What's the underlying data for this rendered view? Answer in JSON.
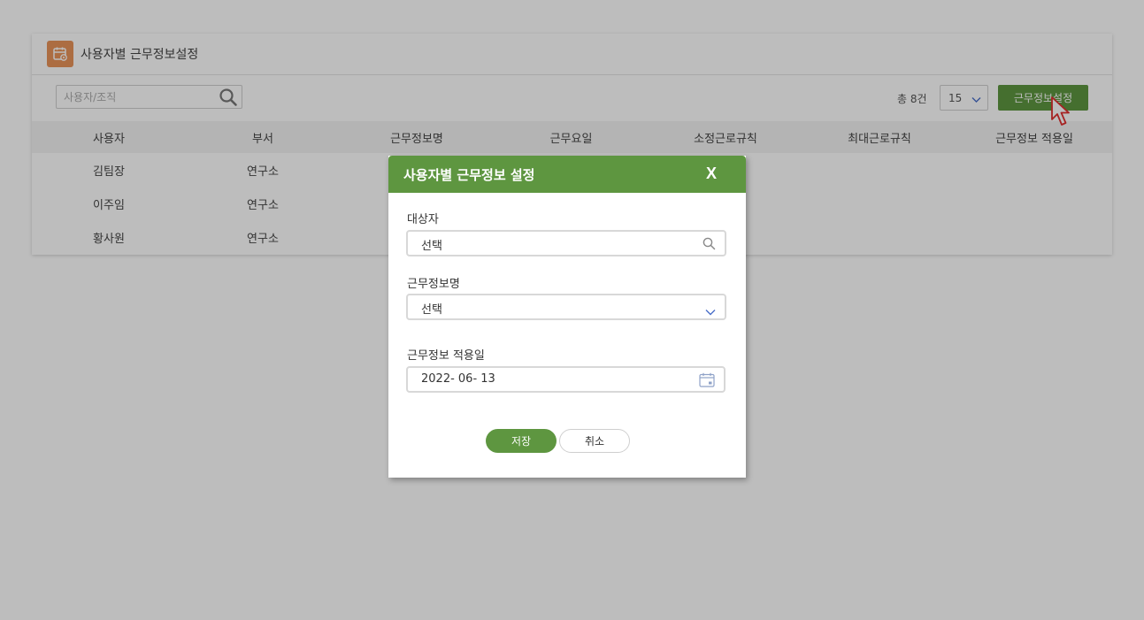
{
  "app": {
    "title": "사용자별 근무정보설정",
    "icon": "calendar-settings-icon",
    "accent_color": "#e8935a"
  },
  "toolbar": {
    "search_placeholder": "사용자/조직",
    "total_text": "총 8건",
    "page_size": "15",
    "set_button_label": "근무정보설정",
    "brand_color": "#5e9640"
  },
  "table": {
    "columns": [
      "사용자",
      "부서",
      "근무정보명",
      "근무요일",
      "소정근로규칙",
      "최대근로규칙",
      "근무정보 적용일"
    ],
    "rows": [
      [
        "김팀장",
        "연구소",
        "",
        "",
        "",
        "",
        ""
      ],
      [
        "이주임",
        "연구소",
        "",
        "",
        "",
        "",
        ""
      ],
      [
        "황사원",
        "연구소",
        "",
        "",
        "",
        "",
        ""
      ]
    ]
  },
  "modal": {
    "title": "사용자별 근무정보 설정",
    "close_label": "X",
    "target": {
      "label": "대상자",
      "value": "선택"
    },
    "work_info": {
      "label": "근무정보명",
      "value": "선택"
    },
    "apply_date": {
      "label": "근무정보 적용일",
      "value": "2022- 06- 13"
    },
    "save_label": "저장",
    "cancel_label": "취소"
  }
}
